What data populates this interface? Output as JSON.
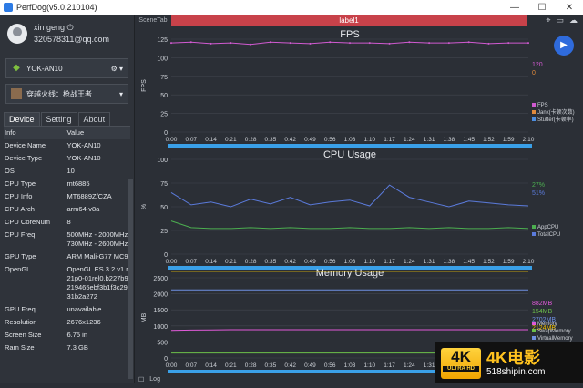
{
  "window": {
    "title": "PerfDog(v5.0.210104)",
    "min": "—",
    "max": "☐",
    "close": "✕"
  },
  "user": {
    "name": "xin geng",
    "email": "320578311@qq.com"
  },
  "device": {
    "name": "YOK-AN10",
    "app": "穿越火线：枪战王者"
  },
  "tabs": [
    "Device",
    "Setting",
    "About"
  ],
  "info": {
    "header_k": "Info",
    "header_v": "Value",
    "rows": [
      [
        "Device Name",
        "YOK-AN10"
      ],
      [
        "Device Type",
        "YOK-AN10"
      ],
      [
        "OS",
        "10"
      ],
      [
        "CPU Type",
        "mt6885"
      ],
      [
        "CPU Info",
        "MT6889Z/CZA"
      ],
      [
        "CPU Arch",
        "arm64-v8a"
      ],
      [
        "CPU CoreNum",
        "8"
      ],
      [
        "CPU Freq",
        "500MHz - 2000MHz 730MHz - 2600MHz"
      ],
      [
        "GPU Type",
        "ARM Mali-G77 MC9"
      ],
      [
        "OpenGL",
        "OpenGL ES 3.2 v1.r21p0-01rel0.b227b9219465ebf3b1f3c29f31b2a272"
      ],
      [
        "GPU Freq",
        "unavailable"
      ],
      [
        "Resolution",
        "2676x1236"
      ],
      [
        "Screen Size",
        "6.75 in"
      ],
      [
        "Ram Size",
        "7.3 GB"
      ]
    ]
  },
  "topbar": {
    "scene": "SceneTab",
    "label": "label1"
  },
  "bottom": {
    "label": "Log"
  },
  "colors": {
    "fps": "#d05ad0",
    "app": "#4caf50",
    "total": "#5b7bdc",
    "mem": "#e05ad8",
    "swap": "#6cc04a",
    "virt": "#6e8fe0",
    "avail": "#f0c000"
  },
  "chart_data": [
    {
      "type": "line",
      "title": "FPS",
      "ylabel": "FPS",
      "ylim": [
        0,
        125
      ],
      "yticks": [
        0,
        25,
        50,
        75,
        100,
        125
      ],
      "x": [
        "0:00",
        "0:07",
        "0:14",
        "0:21",
        "0:28",
        "0:35",
        "0:42",
        "0:49",
        "0:56",
        "1:03",
        "1:10",
        "1:17",
        "1:24",
        "1:31",
        "1:38",
        "1:45",
        "1:52",
        "1:59",
        "2:10"
      ],
      "series": [
        {
          "name": "FPS",
          "values": [
            120,
            121,
            119,
            120,
            118,
            121,
            120,
            119,
            121,
            120,
            120,
            119,
            121,
            120,
            120,
            121,
            119,
            120,
            120
          ]
        }
      ],
      "legend": [
        "FPS",
        "Jank(卡顿次数)",
        "Stutter(卡顿率)"
      ],
      "readouts": [
        "120",
        "0"
      ]
    },
    {
      "type": "line",
      "title": "CPU Usage",
      "ylabel": "%",
      "ylim": [
        0,
        100
      ],
      "yticks": [
        0,
        25,
        50,
        75,
        100
      ],
      "x": [
        "0:00",
        "0:07",
        "0:14",
        "0:21",
        "0:28",
        "0:35",
        "0:42",
        "0:49",
        "0:56",
        "1:03",
        "1:10",
        "1:17",
        "1:24",
        "1:31",
        "1:38",
        "1:45",
        "1:52",
        "1:59",
        "2:10"
      ],
      "series": [
        {
          "name": "AppCPU",
          "values": [
            35,
            28,
            27,
            27,
            28,
            27,
            28,
            27,
            27,
            28,
            27,
            27,
            28,
            27,
            28,
            27,
            27,
            28,
            27
          ]
        },
        {
          "name": "TotalCPU",
          "values": [
            65,
            52,
            55,
            50,
            58,
            53,
            60,
            52,
            55,
            57,
            51,
            73,
            60,
            55,
            50,
            56,
            54,
            52,
            51
          ]
        }
      ],
      "legend": [
        "AppCPU",
        "TotalCPU"
      ],
      "readouts": [
        "27%",
        "51%"
      ]
    },
    {
      "type": "line",
      "title": "Memory Usage",
      "ylabel": "MB",
      "ylim": [
        0,
        2500
      ],
      "yticks": [
        0,
        500,
        1000,
        1500,
        2000,
        2500
      ],
      "x": [
        "0:00",
        "0:07",
        "0:14",
        "0:21",
        "0:28",
        "0:35",
        "0:42",
        "0:49",
        "0:56",
        "1:03",
        "1:10",
        "1:17",
        "1:24",
        "1:31",
        "1:38",
        "1:45",
        "1:52",
        "1:59",
        "2:10"
      ],
      "series": [
        {
          "name": "Memory",
          "values": [
            860,
            870,
            875,
            880,
            880,
            880,
            882,
            882,
            882,
            882,
            882,
            882,
            882,
            882,
            882,
            882,
            882,
            882,
            882
          ]
        },
        {
          "name": "SwapMemory",
          "values": [
            154,
            154,
            154,
            154,
            154,
            154,
            154,
            154,
            154,
            154,
            154,
            154,
            154,
            154,
            154,
            154,
            154,
            154,
            154
          ]
        },
        {
          "name": "VirtualMemory",
          "values": [
            2124,
            2124,
            2124,
            2124,
            2124,
            2124,
            2124,
            2124,
            2124,
            2124,
            2124,
            2124,
            2124,
            2124,
            2124,
            2124,
            2124,
            2124,
            2124
          ]
        },
        {
          "name": "AvailableMe...",
          "values": [
            2702,
            2702,
            2702,
            2702,
            2702,
            2702,
            2702,
            2702,
            2702,
            2702,
            2702,
            2702,
            2702,
            2702,
            2702,
            2702,
            2702,
            2702,
            2702
          ]
        }
      ],
      "legend": [
        "Memory",
        "SwapMemory",
        "VirtualMemory",
        "AvailableMe..."
      ],
      "readouts": [
        "882MB",
        "154MB",
        "2702MB",
        "2124MB"
      ]
    }
  ],
  "watermark": {
    "big": "4K",
    "small": "ULTRA HD",
    "text": "4K电影",
    "url": "518shipin.com"
  }
}
